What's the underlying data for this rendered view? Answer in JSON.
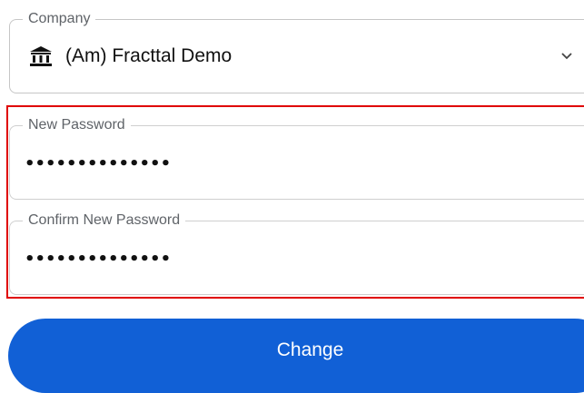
{
  "company": {
    "label": "Company",
    "value": "(Am) Fracttal Demo",
    "icon": "bank-icon",
    "dropdown_icon": "chevron-down-icon"
  },
  "new_password": {
    "label": "New Password",
    "value": "••••••••••••••"
  },
  "confirm_password": {
    "label": "Confirm New Password",
    "value": "••••••••••••••"
  },
  "change_button": {
    "label": "Change"
  },
  "colors": {
    "primary": "#1160d6",
    "highlight": "#e00000",
    "border": "#c6c6c6",
    "label": "#5f6368"
  }
}
